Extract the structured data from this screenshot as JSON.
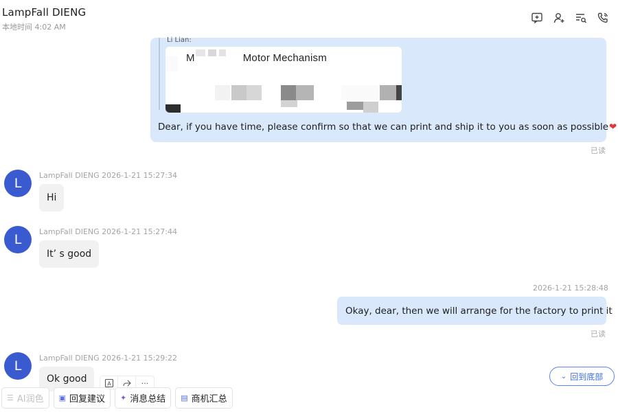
{
  "header": {
    "title": "LampFall DIENG",
    "subtitle": "本地时间 4:02 AM"
  },
  "quoted_message": {
    "author": "Li Lian:",
    "card_title": "Motor Mechanism",
    "card_title_prefix": "M",
    "text": "Dear, if you have time, please confirm so that we can print and ship it to you as soon as possible",
    "status": "已读"
  },
  "messages": [
    {
      "sender": "LampFall DIENG",
      "time": "2026-1-21 15:27:34",
      "text": "Hi",
      "avatar": "L"
    },
    {
      "sender": "LampFall DIENG",
      "time": "2026-1-21 15:27:44",
      "text": "It’ s good",
      "avatar": "L"
    },
    {
      "time": "2026-1-21 15:28:48",
      "text": "Okay, dear, then we will arrange for the factory to print it",
      "status": "已读"
    },
    {
      "sender": "LampFall DIENG",
      "time": "2026-1-21 15:29:22",
      "text": "Ok good",
      "avatar": "L"
    }
  ],
  "back_to_bottom": "回到底部",
  "toolbar": {
    "ai": "AI润色",
    "reply_suggest": "回复建议",
    "summary": "消息总结",
    "business": "商机汇总"
  },
  "hover_tools": {
    "more": "···"
  },
  "colors": {
    "accent": "#3f6ae6",
    "avatar": "#3a5bd0",
    "out_bubble": "#d9e9fb",
    "in_bubble": "#f1f1f1"
  }
}
